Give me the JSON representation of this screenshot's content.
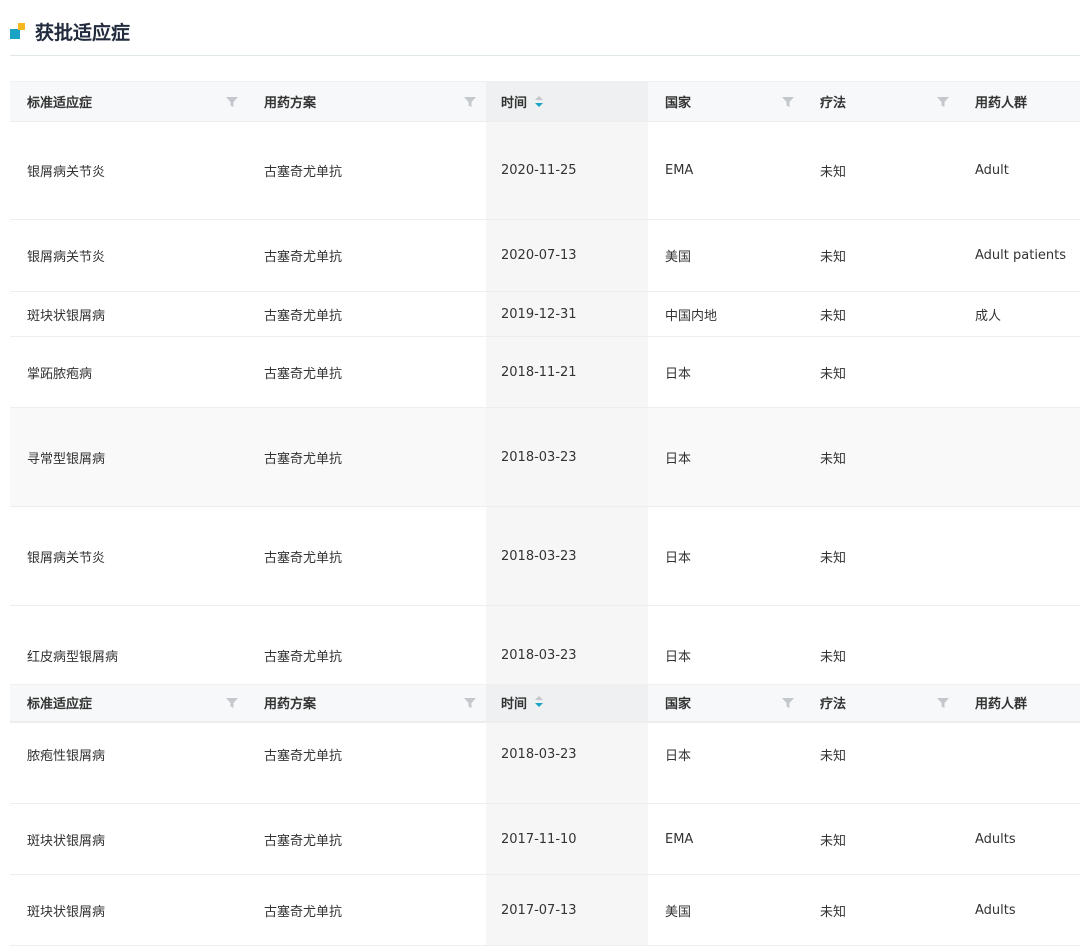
{
  "section": {
    "title": "获批适应症"
  },
  "columns": [
    {
      "label": "标准适应症",
      "filterable": true
    },
    {
      "label": "用药方案",
      "filterable": true
    },
    {
      "label": "时间",
      "sortable": true,
      "sort": "descending"
    },
    {
      "label": "国家",
      "filterable": true
    },
    {
      "label": "疗法",
      "filterable": true
    },
    {
      "label": "用药人群",
      "filterable": false
    }
  ],
  "rows": [
    {
      "indication": "银屑病关节炎",
      "regimen": "古塞奇尤单抗",
      "date": "2020-11-25",
      "country": "EMA",
      "therapy": "未知",
      "population": "Adult"
    },
    {
      "indication": "银屑病关节炎",
      "regimen": "古塞奇尤单抗",
      "date": "2020-07-13",
      "country": "美国",
      "therapy": "未知",
      "population": "Adult patients"
    },
    {
      "indication": "斑块状银屑病",
      "regimen": "古塞奇尤单抗",
      "date": "2019-12-31",
      "country": "中国内地",
      "therapy": "未知",
      "population": "成人"
    },
    {
      "indication": "掌跖脓疱病",
      "regimen": "古塞奇尤单抗",
      "date": "2018-11-21",
      "country": "日本",
      "therapy": "未知",
      "population": ""
    },
    {
      "indication": "寻常型银屑病",
      "regimen": "古塞奇尤单抗",
      "date": "2018-03-23",
      "country": "日本",
      "therapy": "未知",
      "population": ""
    },
    {
      "indication": "银屑病关节炎",
      "regimen": "古塞奇尤单抗",
      "date": "2018-03-23",
      "country": "日本",
      "therapy": "未知",
      "population": ""
    },
    {
      "indication": "红皮病型银屑病",
      "regimen": "古塞奇尤单抗",
      "date": "2018-03-23",
      "country": "日本",
      "therapy": "未知",
      "population": ""
    },
    {
      "indication": "脓疱性银屑病",
      "regimen": "古塞奇尤单抗",
      "date": "2018-03-23",
      "country": "日本",
      "therapy": "未知",
      "population": ""
    },
    {
      "indication": "斑块状银屑病",
      "regimen": "古塞奇尤单抗",
      "date": "2017-11-10",
      "country": "EMA",
      "therapy": "未知",
      "population": "Adults"
    },
    {
      "indication": "斑块状银屑病",
      "regimen": "古塞奇尤单抗",
      "date": "2017-07-13",
      "country": "美国",
      "therapy": "未知",
      "population": "Adults"
    }
  ],
  "colors": {
    "accent": "#1aa3c4",
    "marker_secondary": "#f5b81e",
    "title": "#222c3e",
    "header_bg": "#f7f8f9"
  },
  "icons": {
    "filter": "filter-icon",
    "sort": "sort-icon"
  }
}
